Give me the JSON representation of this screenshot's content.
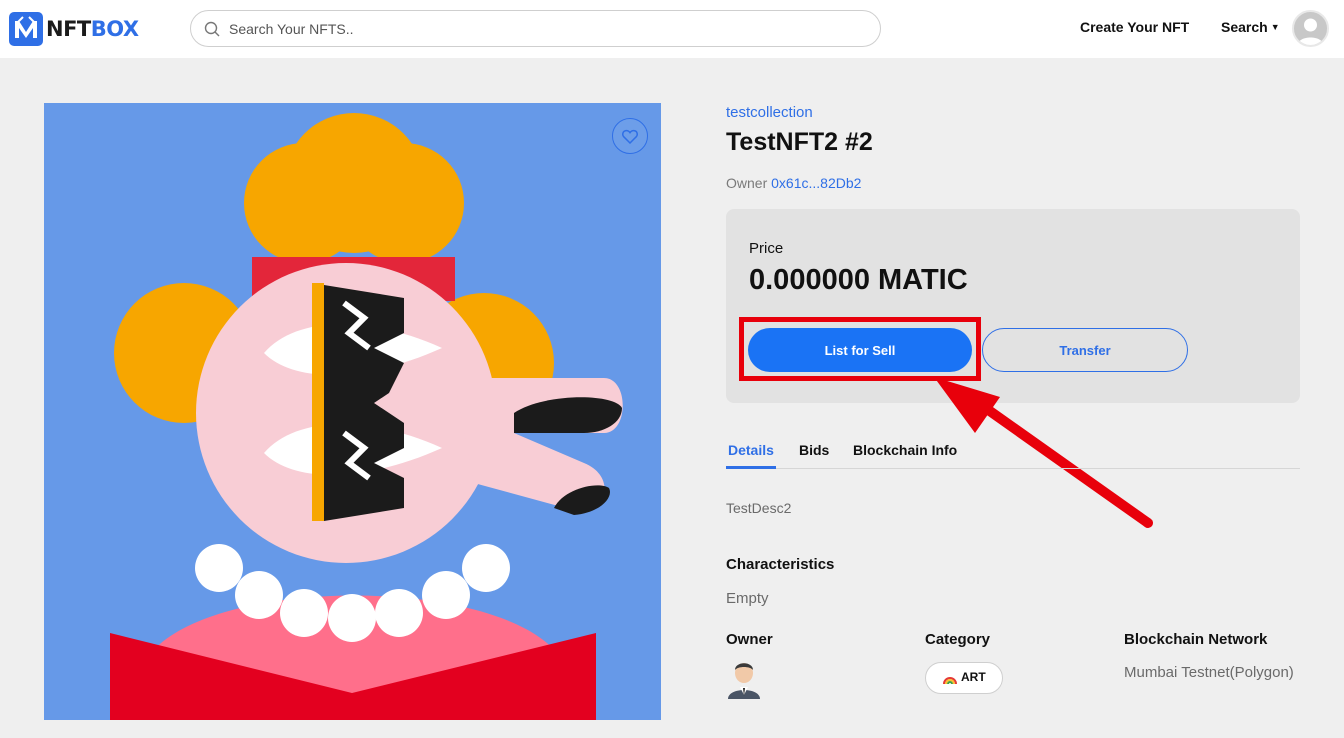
{
  "header": {
    "logo_nft": "NFT",
    "logo_box": "BOX",
    "search_placeholder": "Search Your NFTS..",
    "nav_create": "Create Your NFT",
    "nav_search": "Search"
  },
  "item": {
    "collection": "testcollection",
    "title": "TestNFT2 #2",
    "owner_label": "Owner",
    "owner_address": "0x61c...82Db2",
    "price_label": "Price",
    "price_value": "0.000000 MATIC",
    "list_button": "List for Sell",
    "transfer_button": "Transfer"
  },
  "tabs": [
    {
      "label": "Details",
      "active": true
    },
    {
      "label": "Bids",
      "active": false
    },
    {
      "label": "Blockchain Info",
      "active": false
    }
  ],
  "details": {
    "description": "TestDesc2",
    "characteristics_heading": "Characteristics",
    "characteristics_value": "Empty",
    "owner_heading": "Owner",
    "category_heading": "Category",
    "category_value": "ART",
    "network_heading": "Blockchain Network",
    "network_value": "Mumbai Testnet(Polygon)"
  },
  "icons": {
    "search": "search-icon",
    "caret": "caret-down-icon",
    "favorite": "heart-icon",
    "category": "rainbow-icon"
  },
  "colors": {
    "accent": "#2f6fe6",
    "primary_button": "#1a73f5",
    "annotation_red": "#e8000b",
    "artwork_background": "#6699e8"
  }
}
